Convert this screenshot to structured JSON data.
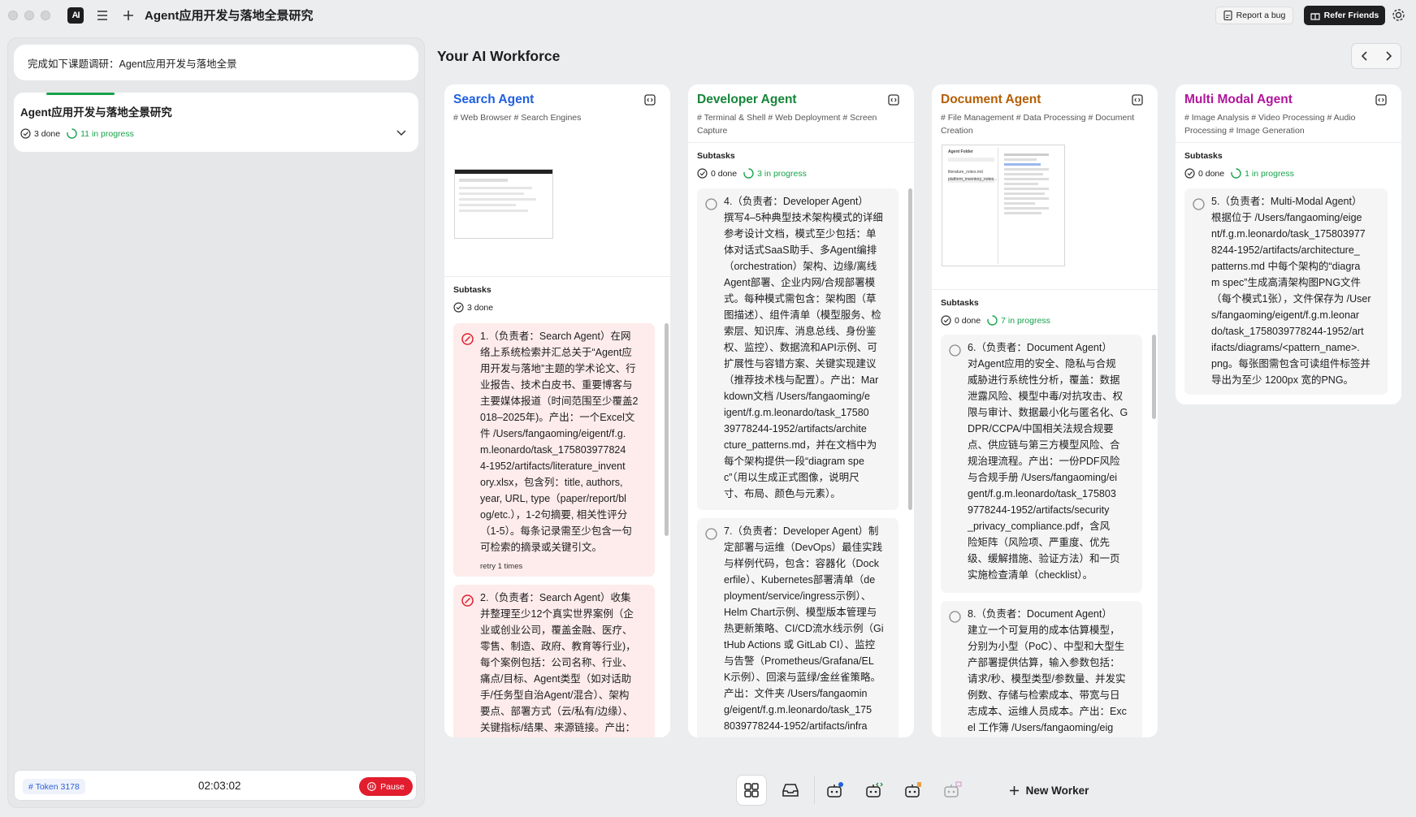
{
  "window": {
    "title": "Agent应用开发与落地全景研究",
    "logo_text": "AI"
  },
  "header": {
    "report_bug": "Report a bug",
    "refer_friends": "Refer Friends"
  },
  "left": {
    "task_prompt": "完成如下课题调研：Agent应用开发与落地全景",
    "project": {
      "title": "Agent应用开发与落地全景研究",
      "done": "3 done",
      "in_progress": "11 in progress"
    },
    "token": "# Token 3178",
    "timer": "02:03:02",
    "pause": "Pause"
  },
  "workforce": {
    "title": "Your AI Workforce"
  },
  "agents": [
    {
      "name": "Search Agent",
      "color": "#1f5fe0",
      "tags": "# Web Browser # Search Engines",
      "subtasks_label": "Subtasks",
      "done": "3 done",
      "tasks": [
        {
          "status": "failed",
          "lines": [
            "1.（负责者：Search Agent）在网",
            "络上系统检索并汇总关于“Agent应",
            "用开发与落地”主题的学术论文、行",
            "业报告、技术白皮书、重要博客与",
            "主要媒体报道（时间范围至少覆盖2",
            "018–2025年)。产出：一个Excel文",
            "件 /Users/fangaoming/eigent/f.g.",
            "m.leonardo/task_175803977824",
            "4-1952/artifacts/literature_invent",
            "ory.xlsx，包含列：title, authors,",
            "year, URL, type（paper/report/bl",
            "og/etc.），1-2句摘要, 相关性评分",
            "（1-5）。每条记录需至少包含一句",
            "可检索的摘录或关键引文。"
          ],
          "retry": "retry 1 times"
        },
        {
          "status": "failed",
          "lines": [
            "2.（负责者：Search Agent）收集",
            "并整理至少12个真实世界案例（企",
            "业或创业公司，覆盖金融、医疗、",
            "零售、制造、政府、教育等行业)，",
            "每个案例包括：公司名称、行业、",
            "痛点/目标、Agent类型（如对话助",
            "手/任务型自治Agent/混合）、架构",
            "要点、部署方式（云/私有/边缘）、",
            "关键指标/结果、来源链接。产出："
          ]
        }
      ]
    },
    {
      "name": "Developer Agent",
      "color": "#17853a",
      "tags": "# Terminal & Shell # Web Deployment # Screen Capture",
      "tags_lines": [
        "# Terminal & Shell # Web Deployment # Screen",
        "Capture"
      ],
      "subtasks_label": "Subtasks",
      "done": "0 done",
      "in_progress": "3 in progress",
      "tasks": [
        {
          "status": "pending",
          "lines": [
            "4.（负责者：Developer Agent）",
            "撰写4–5种典型技术架构模式的详细",
            "参考设计文档，模式至少包括：单",
            "体对话式SaaS助手、多Agent编排",
            "（orchestration）架构、边缘/离线",
            "Agent部署、企业内网/合规部署模",
            "式。每种模式需包含：架构图（草",
            "图描述）、组件清单（模型服务、检",
            "索层、知识库、消息总线、身份鉴",
            "权、监控）、数据流和API示例、可",
            "扩展性与容错方案、关键实现建议",
            "（推荐技术栈与配置）。产出：Mar",
            "kdown文档 /Users/fangaoming/e",
            "igent/f.g.m.leonardo/task_17580",
            "39778244-1952/artifacts/archite",
            "cture_patterns.md，并在文档中为",
            "每个架构提供一段“diagram spe",
            "c”（用以生成正式图像，说明尺",
            "寸、布局、颜色与元素）。"
          ]
        },
        {
          "status": "pending",
          "lines": [
            "7.（负责者：Developer Agent）制",
            "定部署与运维（DevOps）最佳实践",
            "与样例代码，包含：容器化（Dock",
            "erfile）、Kubernetes部署清单（de",
            "ployment/service/ingress示例）、",
            "Helm Chart示例、模型版本管理与",
            "热更新策略、CI/CD流水线示例（Gi",
            "tHub Actions 或 GitLab CI）、监控",
            "与告警（Prometheus/Grafana/EL",
            "K示例）、回滚与蓝绿/金丝雀策略。",
            "产出：文件夹 /Users/fangaomin",
            "g/eigent/f.g.m.leonardo/task_175",
            "8039778244-1952/artifacts/infra"
          ]
        }
      ]
    },
    {
      "name": "Document Agent",
      "color": "#b45f06",
      "tags_lines": [
        "# File Management # Data Processing # Document",
        "Creation"
      ],
      "subtasks_label": "Subtasks",
      "done": "0 done",
      "in_progress": "7 in progress",
      "tasks": [
        {
          "status": "pending",
          "lines": [
            "6.（负责者：Document Agent）",
            "对Agent应用的安全、隐私与合规",
            "威胁进行系统性分析，覆盖：数据",
            "泄露风险、模型中毒/对抗攻击、权",
            "限与审计、数据最小化与匿名化、G",
            "DPR/CCPA/中国相关法规合规要",
            "点、供应链与第三方模型风险、合",
            "规治理流程。产出：一份PDF风险",
            "与合规手册 /Users/fangaoming/ei",
            "gent/f.g.m.leonardo/task_175803",
            "9778244-1952/artifacts/security",
            "_privacy_compliance.pdf，含风",
            "险矩阵（风险项、严重度、优先",
            "级、缓解措施、验证方法）和一页",
            "实施检查清单（checklist）。"
          ]
        },
        {
          "status": "pending",
          "lines": [
            "8.（负责者：Document Agent）",
            "建立一个可复用的成本估算模型，",
            "分别为小型（PoC）、中型和大型生",
            "产部署提供估算，输入参数包括：",
            "请求/秒、模型类型/参数量、并发实",
            "例数、存储与检索成本、带宽与日",
            "志成本、运维人员成本。产出：Exc",
            "el 工作簿 /Users/fangaoming/eig"
          ]
        }
      ],
      "preview": {
        "folder": "Agent Folder",
        "file1": "literature_notes.md",
        "file2": "platform_inventory_notes..."
      }
    },
    {
      "name": "Multi Modal Agent",
      "color": "#b0169a",
      "tags_lines": [
        "# Image Analysis # Video Processing # Audio",
        "Processing # Image Generation"
      ],
      "subtasks_label": "Subtasks",
      "done": "0 done",
      "in_progress": "1 in progress",
      "tasks": [
        {
          "status": "pending",
          "lines": [
            "5.（负责者：Multi-Modal Agent）",
            "根据位于 /Users/fangaoming/eige",
            "nt/f.g.m.leonardo/task_175803977",
            "8244-1952/artifacts/architecture_",
            "patterns.md 中每个架构的“diagra",
            "m spec”生成高清架构图PNG文件",
            "（每个模式1张），文件保存为 /User",
            "s/fangaoming/eigent/f.g.m.leonar",
            "do/task_1758039778244-1952/art",
            "ifacts/diagrams/<pattern_name>.",
            "png。每张图需包含可读组件标签并",
            "导出为至少 1200px 宽的PNG。"
          ]
        }
      ]
    }
  ],
  "dock": {
    "new_worker": "New Worker"
  },
  "colors": {
    "green": "#16a34a",
    "red": "#e11d2e",
    "blue": "#2e5fd8"
  }
}
